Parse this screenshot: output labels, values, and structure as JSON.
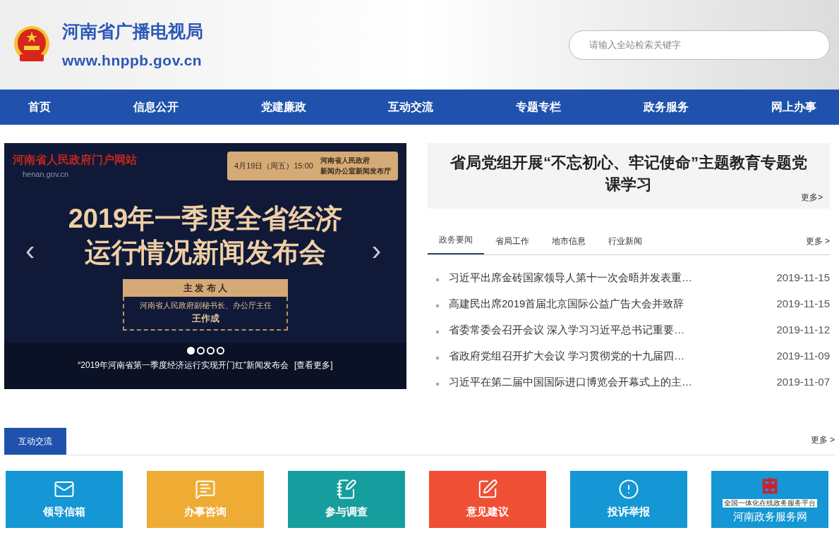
{
  "header": {
    "site_name": "河南省广播电视局",
    "site_url": "www.hnppb.gov.cn",
    "search": {
      "placeholder": "请输入全站检索关键字"
    }
  },
  "nav": [
    {
      "label": "首页",
      "selected": false
    },
    {
      "label": "信息公开",
      "selected": false
    },
    {
      "label": "党建廉政",
      "selected": false
    },
    {
      "label": "互动交流",
      "selected": false
    },
    {
      "label": "专题专栏",
      "selected": false
    },
    {
      "label": "政务服务",
      "selected": false
    },
    {
      "label": "网上办事",
      "selected": false
    }
  ],
  "slider": {
    "graphic": {
      "portal_name": "河南省人民政府门户网站",
      "portal_url": "henan.gov.cn",
      "date": "4月19日（周五）15:00",
      "venue_1": "河南省人民政府",
      "venue_2": "新闻办公室新闻发布厅",
      "headline_1": "2019年一季度全省经济",
      "headline_2": "运行情况新闻发布会",
      "speaker_label": "主 发 布 人",
      "speaker_title": "河南省人民政府副秘书长、办公厅主任",
      "speaker_name": "王作成"
    },
    "prev": "‹",
    "next": "›",
    "dots": [
      {
        "selected": true
      },
      {
        "selected": false
      },
      {
        "selected": false
      },
      {
        "selected": false
      }
    ],
    "caption": "“2019年河南省第一季度经济运行实现开门红”新闻发布会",
    "caption_link": "[查看更多]"
  },
  "feature": {
    "title": "省局党组开展“不忘初心、牢记使命”主题教育专题党课学习",
    "more": "更多>"
  },
  "news": {
    "tabs": [
      {
        "label": "政务要闻",
        "selected": true
      },
      {
        "label": "省局工作",
        "selected": false
      },
      {
        "label": "地市信息",
        "selected": false
      },
      {
        "label": "行业新闻",
        "selected": false
      }
    ],
    "more": "更多 >",
    "items": [
      {
        "title": "习近平出席金砖国家领导人第十一次会晤并发表重…",
        "date": "2019-11-15"
      },
      {
        "title": "高建民出席2019首届北京国际公益广告大会并致辞",
        "date": "2019-11-15"
      },
      {
        "title": "省委常委会召开会议 深入学习习近平总书记重要…",
        "date": "2019-11-12"
      },
      {
        "title": "省政府党组召开扩大会议 学习贯彻党的十九届四…",
        "date": "2019-11-09"
      },
      {
        "title": "习近平在第二届中国国际进口博览会开幕式上的主…",
        "date": "2019-11-07"
      }
    ]
  },
  "interaction": {
    "title": "互动交流",
    "more": "更多 >",
    "services": [
      {
        "kind": "mail",
        "label": "领导信箱",
        "color": "#1497d4"
      },
      {
        "kind": "chat",
        "label": "办事咨询",
        "color": "#eeac35"
      },
      {
        "kind": "survey",
        "label": "参与调查",
        "color": "#169e9e"
      },
      {
        "kind": "edit",
        "label": "意见建议",
        "color": "#ef4f35"
      },
      {
        "kind": "alert",
        "label": "投诉举报",
        "color": "#1497d4"
      },
      {
        "kind": "logo",
        "label": "河南政务服务网",
        "sublabel": "全国一体化在线政务服务平台",
        "color": "#1497d4"
      }
    ]
  }
}
